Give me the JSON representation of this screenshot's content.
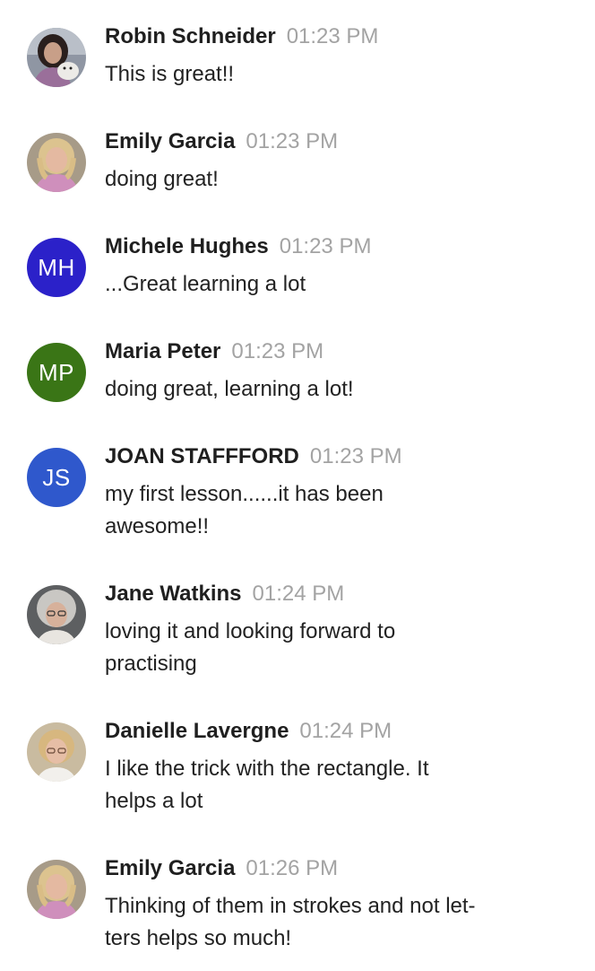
{
  "messages": [
    {
      "name": "Robin Schneider",
      "time": "01:23 PM",
      "text": "This is great!!",
      "avatar": {
        "type": "photo",
        "icon": "avatar-photo-icon"
      }
    },
    {
      "name": "Emily Garcia",
      "time": "01:23 PM",
      "text": "doing great!",
      "avatar": {
        "type": "photo",
        "icon": "avatar-photo-icon"
      }
    },
    {
      "name": "Michele Hughes",
      "time": "01:23 PM",
      "text": "...Great learning a lot",
      "avatar": {
        "type": "initials",
        "initials": "MH",
        "color": "#2b21c9"
      }
    },
    {
      "name": "Maria Peter",
      "time": "01:23 PM",
      "text": "doing great, learning a lot!",
      "avatar": {
        "type": "initials",
        "initials": "MP",
        "color": "#3a7516"
      }
    },
    {
      "name": "JOAN STAFFFORD",
      "time": "01:23 PM",
      "text_lines": [
        "my first lesson......it has been",
        "awesome!!"
      ],
      "avatar": {
        "type": "initials",
        "initials": "JS",
        "color": "#2f58cc"
      }
    },
    {
      "name": "Jane Watkins",
      "time": "01:24 PM",
      "text_lines": [
        "loving it and looking forward to",
        "practising"
      ],
      "avatar": {
        "type": "photo",
        "icon": "avatar-photo-icon"
      }
    },
    {
      "name": "Danielle Lavergne",
      "time": "01:24 PM",
      "text_lines": [
        "I like the trick with the rectangle. It",
        "helps a lot"
      ],
      "avatar": {
        "type": "photo",
        "icon": "avatar-photo-icon"
      }
    },
    {
      "name": "Emily Garcia",
      "time": "01:26 PM",
      "text_lines": [
        "Thinking of them in strokes and not let-",
        "ters helps so much!"
      ],
      "avatar": {
        "type": "photo",
        "icon": "avatar-photo-icon"
      }
    }
  ]
}
